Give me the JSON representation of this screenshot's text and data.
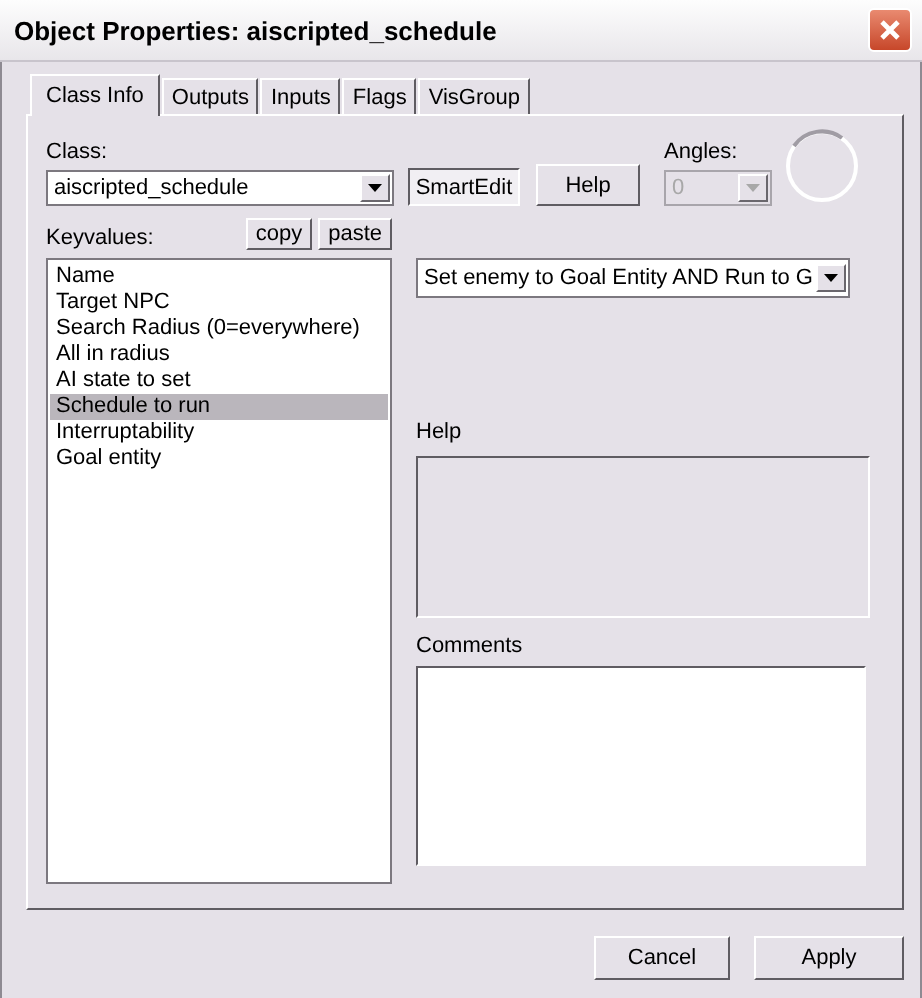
{
  "window": {
    "title": "Object Properties: aiscripted_schedule"
  },
  "tabs": [
    {
      "label": "Class Info",
      "selected": true
    },
    {
      "label": "Outputs",
      "selected": false
    },
    {
      "label": "Inputs",
      "selected": false
    },
    {
      "label": "Flags",
      "selected": false
    },
    {
      "label": "VisGroup",
      "selected": false
    }
  ],
  "class": {
    "label": "Class:",
    "value": "aiscripted_schedule"
  },
  "smartedit": {
    "label": "SmartEdit",
    "on": true
  },
  "help_button": "Help",
  "angles": {
    "label": "Angles:",
    "value": "0",
    "disabled": true
  },
  "keyvalues": {
    "label": "Keyvalues:",
    "copy": "copy",
    "paste": "paste",
    "items": [
      {
        "label": "Name",
        "selected": false
      },
      {
        "label": "Target NPC",
        "selected": false
      },
      {
        "label": "Search Radius (0=everywhere)",
        "selected": false
      },
      {
        "label": "All in radius",
        "selected": false
      },
      {
        "label": "AI state to set",
        "selected": false
      },
      {
        "label": "Schedule to run",
        "selected": true
      },
      {
        "label": "Interruptability",
        "selected": false
      },
      {
        "label": "Goal entity",
        "selected": false
      }
    ]
  },
  "value_dropdown": {
    "value": "Set enemy to Goal Entity AND Run to G"
  },
  "help": {
    "label": "Help"
  },
  "comments": {
    "label": "Comments"
  },
  "buttons": [
    "Cancel",
    "Apply"
  ]
}
